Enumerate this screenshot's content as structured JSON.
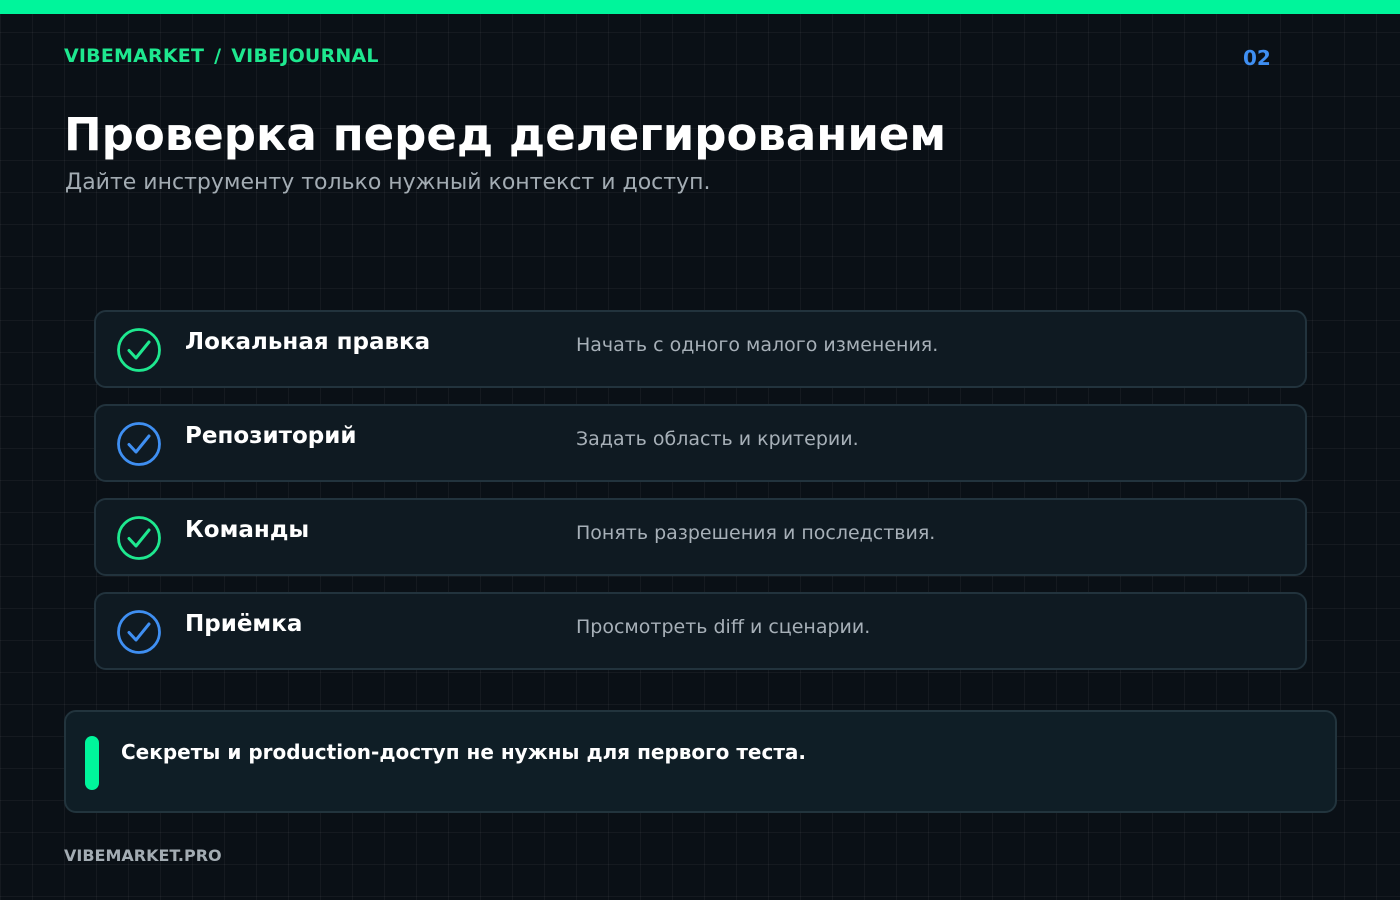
{
  "header": {
    "breadcrumb": [
      "VIBEMARKET",
      "VIBEJOURNAL"
    ],
    "breadcrumb_separator": "/",
    "page_number": "02"
  },
  "main": {
    "title": "Проверка перед делегированием",
    "subtitle": "Дайте инструменту только нужный контекст и доступ.",
    "checklist": [
      {
        "label": "Локальная правка",
        "description": "Начать с одного малого изменения.",
        "icon": "check-circle-icon",
        "color": "#1ee88f"
      },
      {
        "label": "Репозиторий",
        "description": "Задать область и критерии.",
        "icon": "check-circle-icon",
        "color": "#3f8ff2"
      },
      {
        "label": "Команды",
        "description": "Понять разрешения и последствия.",
        "icon": "check-circle-icon",
        "color": "#1ee88f"
      },
      {
        "label": "Приёмка",
        "description": "Просмотреть diff и сценарии.",
        "icon": "check-circle-icon",
        "color": "#3f8ff2"
      }
    ],
    "note": {
      "text": "Секреты и production-доступ не нужны для первого теста.",
      "accent_color": "#00f59b"
    }
  },
  "footer": {
    "brand": "VIBEMARKET.PRO"
  },
  "colors": {
    "accent_green": "#00f59b",
    "accent_blue": "#3f8ff2",
    "background": "#0a1016"
  }
}
